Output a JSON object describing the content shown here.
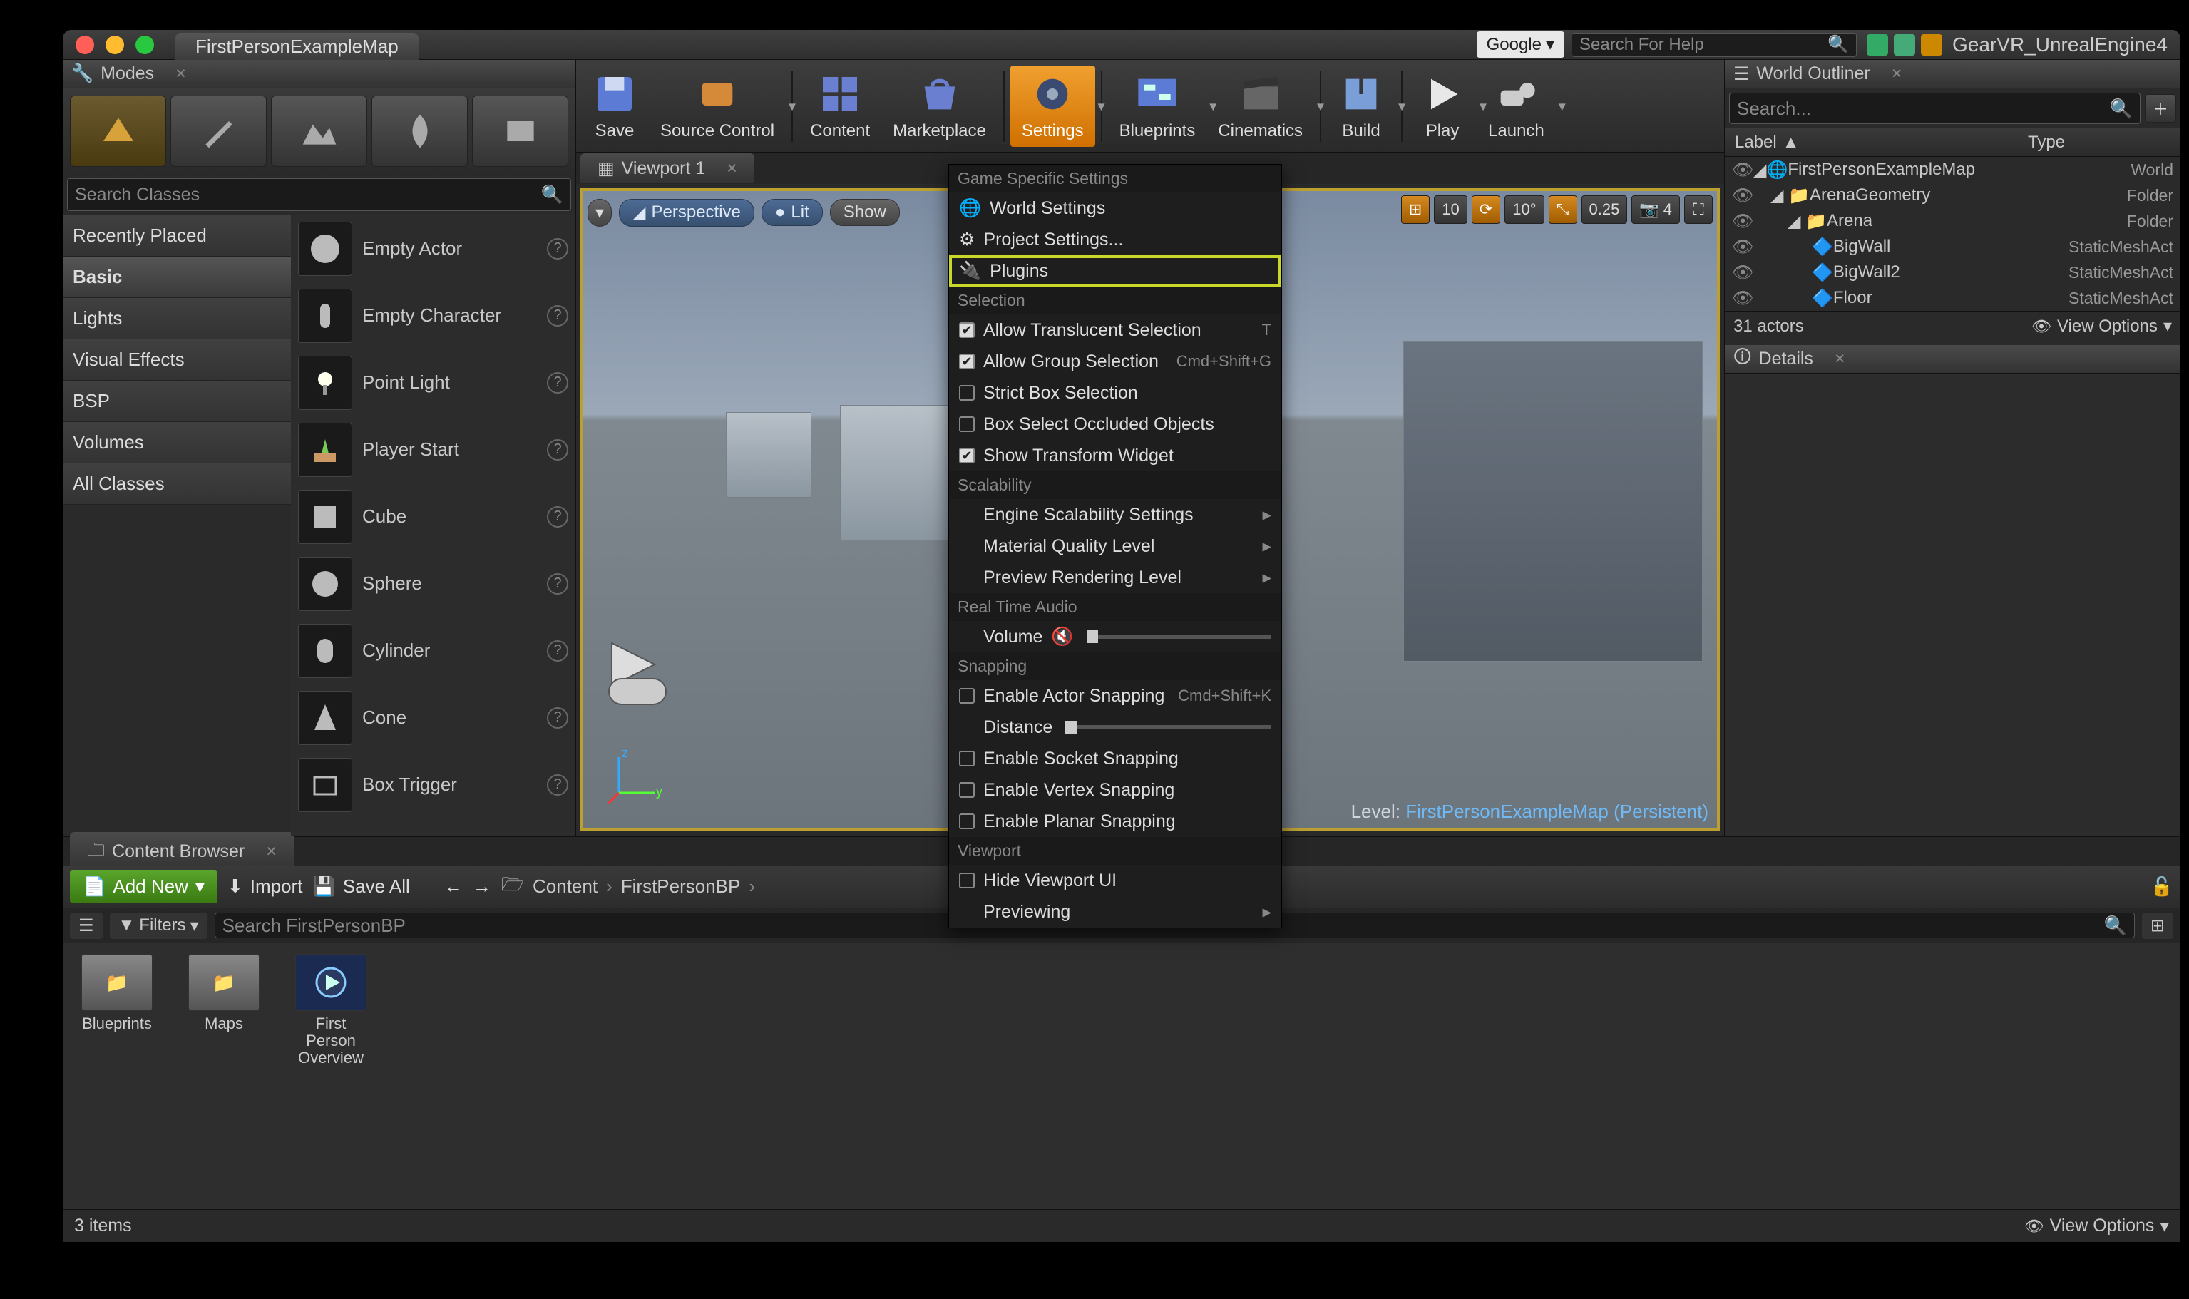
{
  "titlebar": {
    "app_title": "FirstPersonExampleMap",
    "google": "Google",
    "search_placeholder": "Search For Help",
    "project_name": "GearVR_UnrealEngine4"
  },
  "modes": {
    "tab": "Modes",
    "search_placeholder": "Search Classes",
    "categories": [
      "Recently Placed",
      "Basic",
      "Lights",
      "Visual Effects",
      "BSP",
      "Volumes",
      "All Classes"
    ],
    "active_category": "Basic",
    "items": [
      "Empty Actor",
      "Empty Character",
      "Point Light",
      "Player Start",
      "Cube",
      "Sphere",
      "Cylinder",
      "Cone",
      "Box Trigger"
    ]
  },
  "toolbar": {
    "buttons": [
      "Save",
      "Source Control",
      "Content",
      "Marketplace",
      "Settings",
      "Blueprints",
      "Cinematics",
      "Build",
      "Play",
      "Launch"
    ],
    "active": "Settings"
  },
  "viewport": {
    "tab": "Viewport 1",
    "perspective": "Perspective",
    "lit": "Lit",
    "show": "Show",
    "snap_pos": "10",
    "snap_rot": "10°",
    "snap_scale": "0.25",
    "cam_speed": "4",
    "level_label": "Level:",
    "level_name": "FirstPersonExampleMap (Persistent)"
  },
  "settings_menu": {
    "sec_game": "Game Specific Settings",
    "world_settings": "World Settings",
    "project_settings": "Project Settings...",
    "plugins": "Plugins",
    "sec_selection": "Selection",
    "allow_translucent": "Allow Translucent Selection",
    "allow_translucent_kb": "T",
    "allow_group": "Allow Group Selection",
    "allow_group_kb": "Cmd+Shift+G",
    "strict_box": "Strict Box Selection",
    "box_occluded": "Box Select Occluded Objects",
    "show_transform": "Show Transform Widget",
    "sec_scalability": "Scalability",
    "engine_scalability": "Engine Scalability Settings",
    "material_quality": "Material Quality Level",
    "preview_render": "Preview Rendering Level",
    "sec_audio": "Real Time Audio",
    "volume": "Volume",
    "sec_snapping": "Snapping",
    "enable_actor_snap": "Enable Actor Snapping",
    "enable_actor_snap_kb": "Cmd+Shift+K",
    "distance": "Distance",
    "enable_socket": "Enable Socket Snapping",
    "enable_vertex": "Enable Vertex Snapping",
    "enable_planar": "Enable Planar Snapping",
    "sec_viewport": "Viewport",
    "hide_vp_ui": "Hide Viewport UI",
    "previewing": "Previewing"
  },
  "outliner": {
    "tab": "World Outliner",
    "search_placeholder": "Search...",
    "col_label": "Label",
    "col_type": "Type",
    "rows": [
      {
        "indent": 0,
        "label": "FirstPersonExampleMap",
        "type": "World",
        "icon": "world"
      },
      {
        "indent": 1,
        "label": "ArenaGeometry",
        "type": "Folder",
        "icon": "folder"
      },
      {
        "indent": 2,
        "label": "Arena",
        "type": "Folder",
        "icon": "folder"
      },
      {
        "indent": 3,
        "label": "BigWall",
        "type": "StaticMeshAct",
        "icon": "mesh"
      },
      {
        "indent": 3,
        "label": "BigWall2",
        "type": "StaticMeshAct",
        "icon": "mesh"
      },
      {
        "indent": 3,
        "label": "Floor",
        "type": "StaticMeshAct",
        "icon": "mesh"
      }
    ],
    "actor_count": "31 actors",
    "view_options": "View Options"
  },
  "details": {
    "tab": "Details"
  },
  "content_browser": {
    "tab": "Content Browser",
    "add_new": "Add New",
    "import": "Import",
    "save_all": "Save All",
    "path_root": "Content",
    "path_sub": "FirstPersonBP",
    "filters": "Filters",
    "search_placeholder": "Search FirstPersonBP",
    "assets": [
      {
        "label": "Blueprints",
        "kind": "folder"
      },
      {
        "label": "Maps",
        "kind": "folder"
      },
      {
        "label": "First\nPerson\nOverview",
        "kind": "blueprint"
      }
    ],
    "item_count": "3 items",
    "view_options": "View Options"
  }
}
